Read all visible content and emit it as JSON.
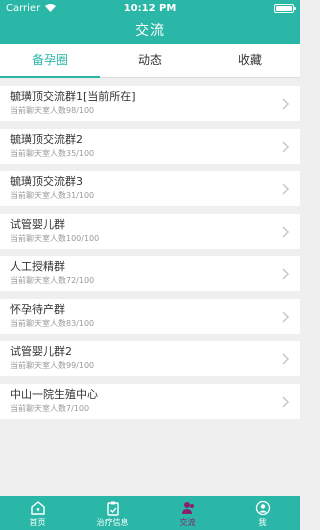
{
  "status_bar": {
    "carrier": "Carrier",
    "time": "10:12 PM"
  },
  "header": {
    "title": "交流"
  },
  "tabs": [
    {
      "label": "备孕圈",
      "active": true
    },
    {
      "label": "动态",
      "active": false
    },
    {
      "label": "收藏",
      "active": false
    }
  ],
  "rooms": [
    {
      "name": "毓璜顶交流群1[当前所在]",
      "subtitle": "当前聊天室人数98/100"
    },
    {
      "name": "毓璜顶交流群2",
      "subtitle": "当前聊天室人数35/100"
    },
    {
      "name": "毓璜顶交流群3",
      "subtitle": "当前聊天室人数31/100"
    },
    {
      "name": "试管婴儿群",
      "subtitle": "当前聊天室人数100/100"
    },
    {
      "name": "人工授精群",
      "subtitle": "当前聊天室人数72/100"
    },
    {
      "name": "怀孕待产群",
      "subtitle": "当前聊天室人数83/100"
    },
    {
      "name": "试管婴儿群2",
      "subtitle": "当前聊天室人数99/100"
    },
    {
      "name": "中山一院生殖中心",
      "subtitle": "当前聊天室人数7/100"
    }
  ],
  "bottom_tabs": [
    {
      "label": "首页",
      "icon": "home-icon"
    },
    {
      "label": "治疗信息",
      "icon": "clipboard-icon"
    },
    {
      "label": "交流",
      "icon": "chat-icon",
      "active": true
    },
    {
      "label": "我",
      "icon": "user-icon"
    }
  ],
  "colors": {
    "primary": "#2bb7a7",
    "active_tab_icon": "#8a1f6e",
    "background": "#efefef"
  }
}
